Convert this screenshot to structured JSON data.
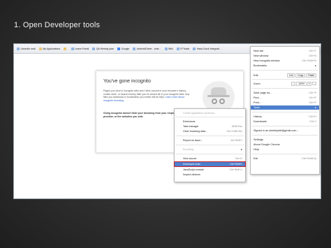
{
  "slide": {
    "title": "1. Open Developer tools"
  },
  "bookmarks": [
    {
      "label": "LinkedIn mail",
      "icon": "linkedin-icon"
    },
    {
      "label": "My Applications",
      "icon": "folder-icon"
    },
    {
      "label": "",
      "icon": "folder-icon"
    },
    {
      "label": "Leave Portal",
      "icon": "page-icon"
    },
    {
      "label": "Qb Weekly plan",
      "icon": "page-icon"
    },
    {
      "label": "Google",
      "icon": "google-icon"
    },
    {
      "label": "AndroidDriver - sele...",
      "icon": "page-icon"
    },
    {
      "label": "Wiki",
      "icon": "page-icon"
    },
    {
      "label": "E*Trade",
      "icon": "page-icon"
    },
    {
      "label": "Hadu Dock Integrati...",
      "icon": "page-icon"
    }
  ],
  "incognito": {
    "title": "You've gone incognito",
    "body": "Pages you view in incognito tabs won't stick around in your browser's history, cookie store, or search history after you've closed all of your incognito tabs. Any files you download or bookmarks you create will be kept.",
    "link": "Learn more about incognito browsing",
    "warning": "Going incognito doesn't hide your browsing from your employer, your internet service provider, or the websites you visit."
  },
  "chrome_menu": {
    "new_tab": {
      "label": "New tab",
      "shortcut": "Ctrl+T"
    },
    "new_window": {
      "label": "New window",
      "shortcut": "Ctrl+N"
    },
    "new_incognito": {
      "label": "New incognito window",
      "shortcut": "Ctrl+Shift+N"
    },
    "bookmarks": {
      "label": "Bookmarks"
    },
    "edit": {
      "label": "Edit",
      "cut": "Cut",
      "copy": "Copy",
      "paste": "Paste"
    },
    "zoom": {
      "label": "Zoom",
      "minus": "-",
      "value": "100%",
      "plus": "+"
    },
    "save_page": {
      "label": "Save page as...",
      "shortcut": "Ctrl+S"
    },
    "find": {
      "label": "Find...",
      "shortcut": "Ctrl+F"
    },
    "print": {
      "label": "Print...",
      "shortcut": "Ctrl+P"
    },
    "tools": {
      "label": "Tools"
    },
    "history": {
      "label": "History",
      "shortcut": "Ctrl+H"
    },
    "downloads": {
      "label": "Downloads",
      "shortcut": "Ctrl+J"
    },
    "signed_in": {
      "label": "Signed in as shekhrjobit@gmail.com..."
    },
    "settings": {
      "label": "Settings"
    },
    "about": {
      "label": "About Google Chrome"
    },
    "help": {
      "label": "Help"
    },
    "exit": {
      "label": "Exit",
      "shortcut": "Ctrl+Shift+Q"
    }
  },
  "tools_menu": {
    "create_shortcuts": {
      "label": "Create application shortcuts..."
    },
    "extensions": {
      "label": "Extensions"
    },
    "task_manager": {
      "label": "Task manager",
      "shortcut": "Shift+Esc"
    },
    "clear_browsing": {
      "label": "Clear browsing data...",
      "shortcut": "Ctrl+Shift+Del"
    },
    "report_issue": {
      "label": "Report an issue...",
      "shortcut": "Alt+Shift+I"
    },
    "encoding": {
      "label": "Encoding"
    },
    "view_source": {
      "label": "View source",
      "shortcut": "Ctrl+U"
    },
    "developer_tools": {
      "label": "Developer tools",
      "shortcut": "Ctrl+Shift+I"
    },
    "javascript_console": {
      "label": "JavaScript console",
      "shortcut": "Ctrl+Shift+J"
    },
    "inspect_devices": {
      "label": "Inspect devices"
    }
  },
  "colors": {
    "highlight": "#4d7fcc",
    "callout": "#cc1f2a",
    "background": "#2e2e2e"
  }
}
